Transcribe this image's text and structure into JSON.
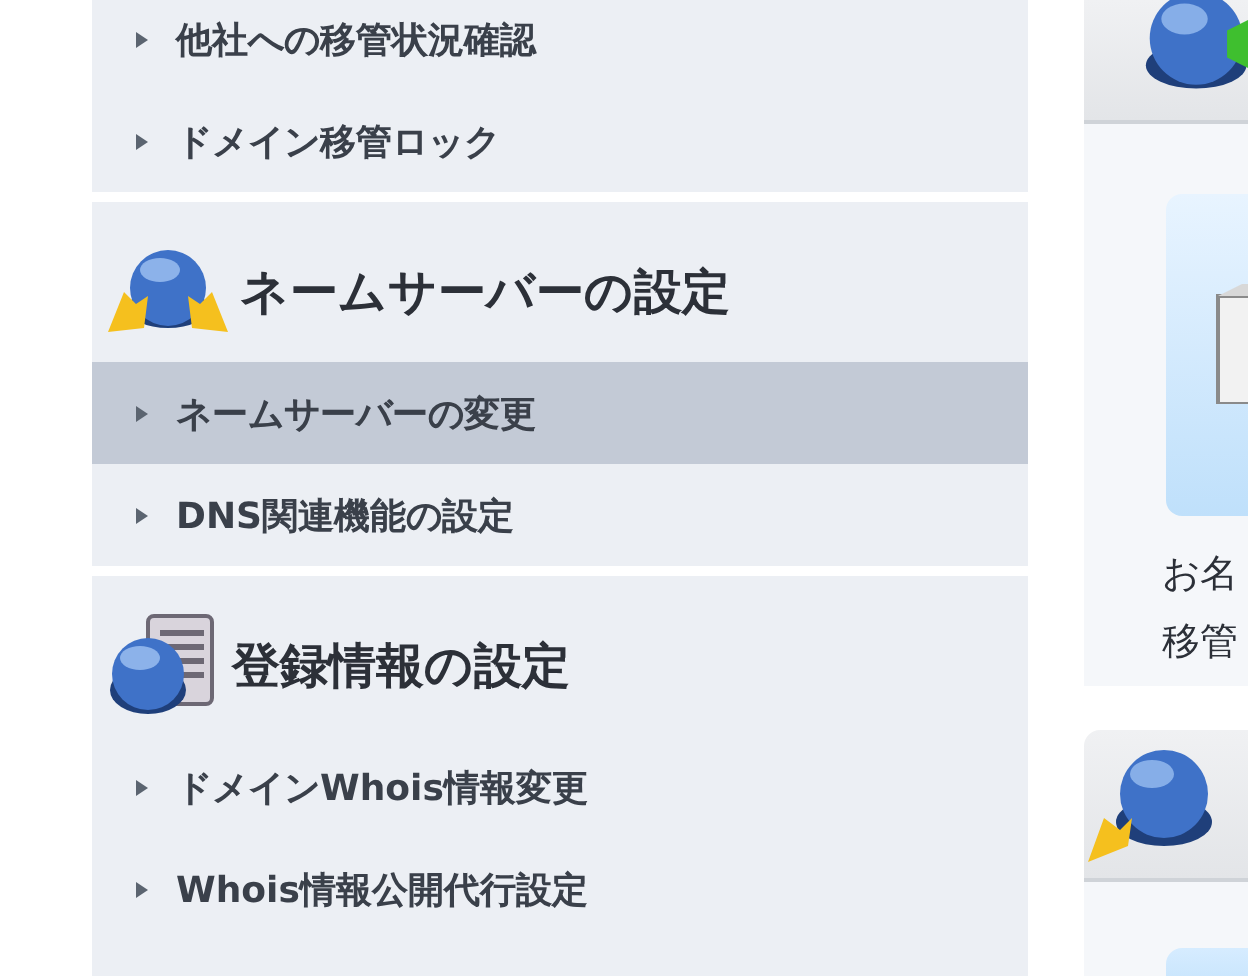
{
  "sidebar": {
    "sections": [
      {
        "kind": "continued",
        "items": [
          {
            "label": "他社への移管状況確認",
            "selected": false
          },
          {
            "label": "ドメイン移管ロック",
            "selected": false
          }
        ]
      },
      {
        "kind": "nameserver",
        "title": "ネームサーバーの設定",
        "items": [
          {
            "label": "ネームサーバーの変更",
            "selected": true
          },
          {
            "label": "DNS関連機能の設定",
            "selected": false
          }
        ]
      },
      {
        "kind": "registration",
        "title": "登録情報の設定",
        "items": [
          {
            "label": "ドメインWhois情報変更",
            "selected": false
          },
          {
            "label": "Whois情報公開代行設定",
            "selected": false
          }
        ]
      }
    ]
  },
  "side_panel": {
    "card_lines": [
      "お名",
      "移管"
    ]
  }
}
